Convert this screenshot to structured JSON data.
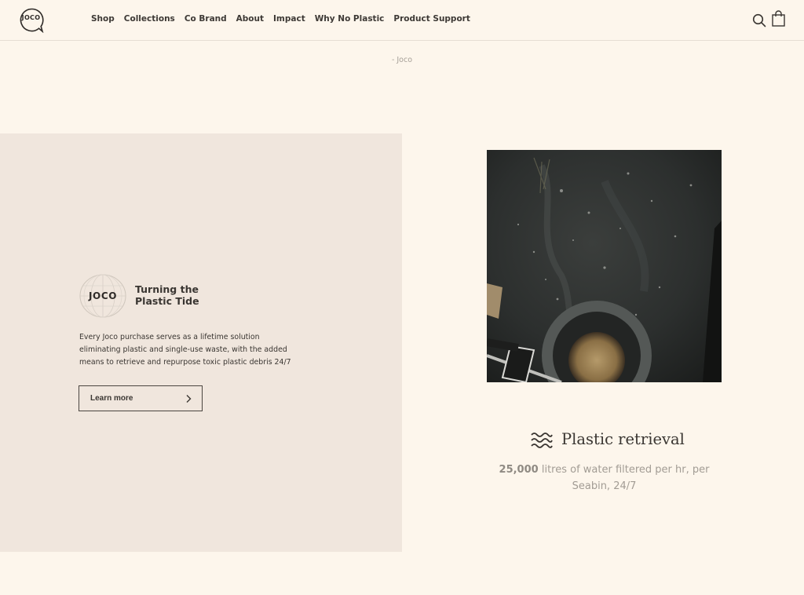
{
  "brand": {
    "logo_text": "JOCO"
  },
  "nav": {
    "items": [
      "Shop",
      "Collections",
      "Co Brand",
      "About",
      "Impact",
      "Why No Plastic",
      "Product Support"
    ]
  },
  "header_icons": {
    "search": "search-icon",
    "cart": "shopping-bag-icon"
  },
  "quote": {
    "attribution": "- Joco"
  },
  "impact_panel": {
    "badge_text": "JOCO",
    "title": "Turning the Plastic Tide",
    "body": "Every Joco purchase serves as a lifetime solution eliminating plastic and single-use waste, with the added means to retrieve and repurpose toxic plastic debris 24/7",
    "button_label": "Learn more"
  },
  "stat": {
    "icon": "waves-icon",
    "title": "Plastic retrieval",
    "value": "25,000",
    "description": "litres of water filtered per hr, per Seabin, 24/7"
  },
  "colors": {
    "background": "#fdf6ec",
    "panel": "#f0e6dd",
    "text": "#3a3632",
    "muted": "#a29c94"
  }
}
